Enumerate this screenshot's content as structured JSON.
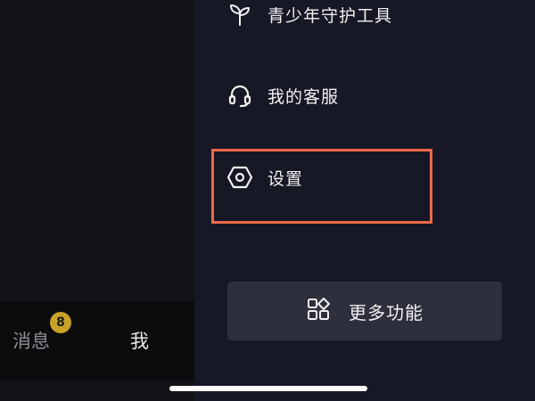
{
  "bottom_nav": {
    "messages_label": "消息",
    "messages_badge": "8",
    "me_label": "我"
  },
  "drawer": {
    "items": [
      {
        "label": "青少年守护工具",
        "icon": "sprout-icon"
      },
      {
        "label": "我的客服",
        "icon": "headset-icon"
      },
      {
        "label": "设置",
        "icon": "hexagon-settings-icon"
      }
    ],
    "more_button": {
      "label": "更多功能",
      "icon": "grid-shapes-icon"
    }
  },
  "colors": {
    "background": "#121318",
    "drawer_background": "#171825",
    "highlight": "#ee6a4a",
    "badge": "#c9a227",
    "button_background": "#2e2f3c"
  }
}
